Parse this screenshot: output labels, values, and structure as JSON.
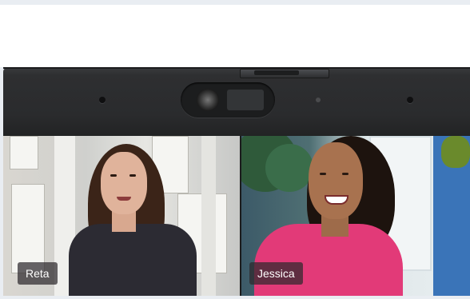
{
  "call": {
    "participants": [
      {
        "name": "Reta"
      },
      {
        "name": "Jessica"
      }
    ]
  },
  "colors": {
    "bezel": "#2e2f31",
    "name_tag_bg": "#2d282d",
    "name_tag_text": "#ffffff",
    "accent_pink": "#e23a78",
    "wall_blue": "#3a74b8"
  },
  "icons": {
    "webcam": "webcam-icon",
    "privacy_shutter": "shutter-icon",
    "microphone": "mic-icon"
  }
}
